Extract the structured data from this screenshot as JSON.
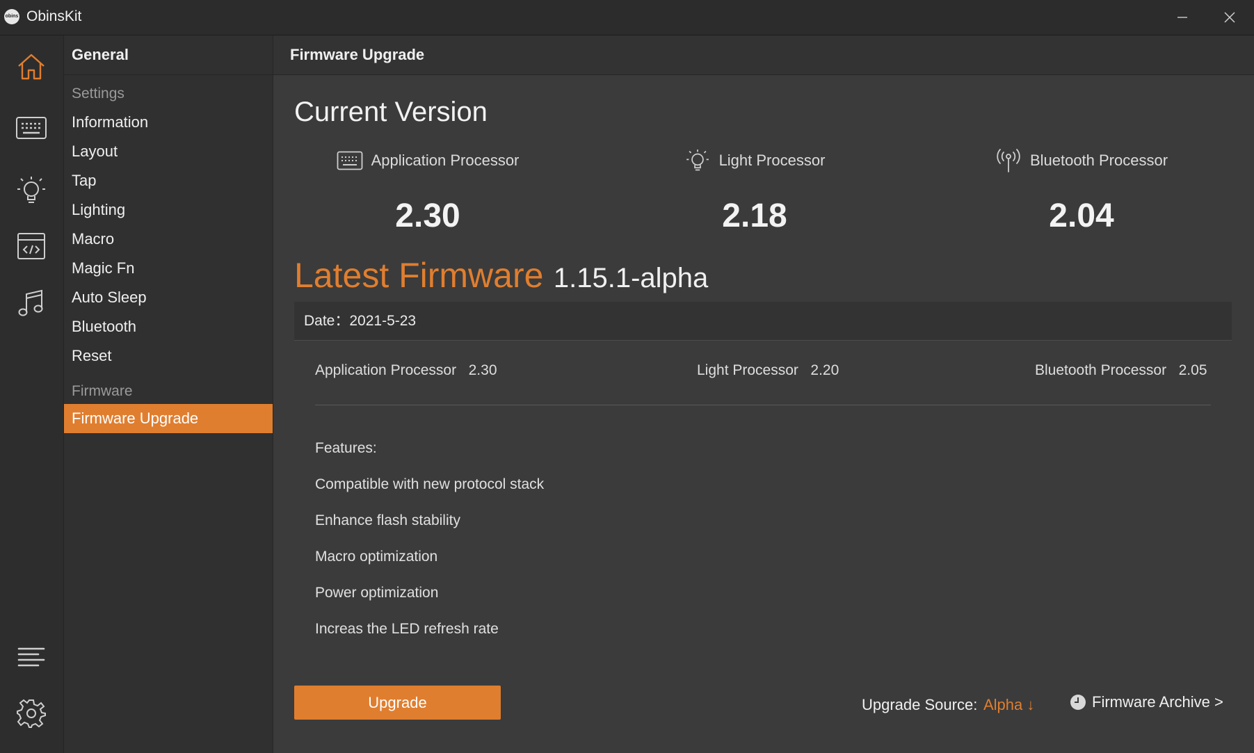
{
  "app": {
    "title": "ObinsKit",
    "logo_text": "obins"
  },
  "nav": {
    "header": "General",
    "group_settings": "Settings",
    "items": [
      {
        "label": "Information"
      },
      {
        "label": "Layout"
      },
      {
        "label": "Tap"
      },
      {
        "label": "Lighting"
      },
      {
        "label": "Macro"
      },
      {
        "label": "Magic Fn"
      },
      {
        "label": "Auto Sleep"
      },
      {
        "label": "Bluetooth"
      },
      {
        "label": "Reset"
      }
    ],
    "group_firmware": "Firmware",
    "active_item": "Firmware Upgrade"
  },
  "rail": {
    "icons": [
      "home-icon",
      "keyboard-icon",
      "lightbulb-icon",
      "code-icon",
      "music-icon",
      "list-icon",
      "gear-icon"
    ]
  },
  "main": {
    "header": "Firmware Upgrade",
    "current_title": "Current Version",
    "processors": [
      {
        "name": "Application Processor",
        "version": "2.30",
        "icon": "keyboard-icon"
      },
      {
        "name": "Light Processor",
        "version": "2.18",
        "icon": "lightbulb-icon"
      },
      {
        "name": "Bluetooth Processor",
        "version": "2.04",
        "icon": "antenna-icon"
      }
    ],
    "latest_label": "Latest Firmware",
    "latest_version": "1.15.1-alpha",
    "date_text": "Date：2021-5-23",
    "latest_versions": [
      {
        "name": "Application Processor",
        "version": "2.30"
      },
      {
        "name": "Light Processor",
        "version": "2.20"
      },
      {
        "name": "Bluetooth Processor",
        "version": "2.05"
      }
    ],
    "features_title": "Features:",
    "features": [
      "Compatible with new protocol stack",
      "Enhance flash stability",
      "Macro optimization",
      "Power optimization",
      "Increas the LED refresh rate"
    ],
    "upgrade_label": "Upgrade",
    "source_label": "Upgrade Source:",
    "source_value": "Alpha ↓",
    "archive_label": "Firmware Archive >"
  },
  "colors": {
    "accent": "#e07e2f",
    "bg": "#3b3b3b",
    "rail": "#2d2d2d",
    "nav": "#303030"
  }
}
